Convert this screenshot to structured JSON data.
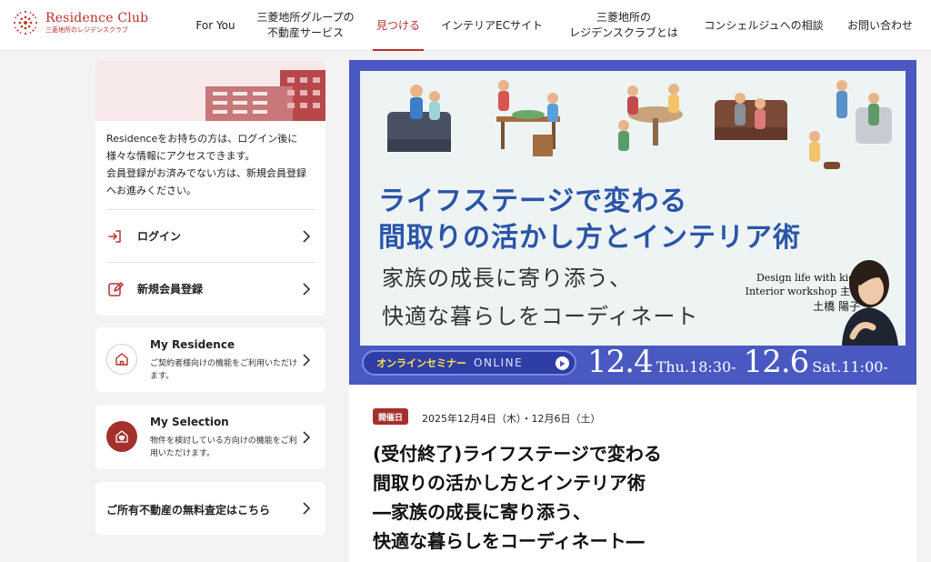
{
  "header": {
    "logo_title": "Residence Club",
    "logo_sub": "三菱地所のレジデンスクラブ",
    "nav": [
      {
        "lines": [
          "For You"
        ]
      },
      {
        "lines": [
          "三菱地所グループの",
          "不動産サービス"
        ]
      },
      {
        "lines": [
          "見つける"
        ],
        "active": true
      },
      {
        "lines": [
          "インテリアECサイト"
        ]
      },
      {
        "lines": [
          "三菱地所の",
          "レジデンスクラブとは"
        ]
      },
      {
        "lines": [
          "コンシェルジュへの相談"
        ]
      },
      {
        "lines": [
          "お問い合わせ"
        ]
      }
    ]
  },
  "sidebar": {
    "login_desc_1": "Residenceをお持ちの方は、ログイン後に",
    "login_desc_2": "様々な情報にアクセスできます。",
    "login_desc_3": "会員登録がお済みでない方は、新規会員登録",
    "login_desc_4": "へお進みください。",
    "login_label": "ログイン",
    "register_label": "新規会員登録",
    "my_residence": {
      "title": "My Residence",
      "desc": "ご契約者様向けの機能をご利用いただけます。"
    },
    "my_selection": {
      "title": "My Selection",
      "desc": "物件を検討している方向けの機能をご利用いただけます。"
    },
    "appraisal_label": "ご所有不動産の無料査定はこちら"
  },
  "banner": {
    "headline_1": "ライフステージで変わる",
    "headline_2": "間取りの活かし方とインテリア術",
    "subline_1": "家族の成長に寄り添う、",
    "subline_2": "快適な暮らしをコーディネート",
    "presenter_1": "Design life with kids",
    "presenter_2": "Interior workshop 主宰",
    "presenter_name": "土橋 陽子",
    "pill_jp": "オンラインセミナー",
    "pill_en": "ONLINE",
    "date1": "12.4",
    "time1": "Thu.18:30-",
    "date2": "12.6",
    "time2": "Sat.11:00-"
  },
  "article": {
    "badge": "開催日",
    "date": "2025年12月4日（木）・12月6日（土）",
    "title_lines": [
      "(受付終了)ライフステージで変わる",
      "間取りの活かし方とインテリア術",
      "―家族の成長に寄り添う、",
      "快適な暮らしをコーディネート―"
    ]
  },
  "colors": {
    "brand": "#b8302d",
    "banner_blue": "#4a59c1",
    "headline_blue": "#2a55a8",
    "pill_yellow": "#ffe24a"
  }
}
